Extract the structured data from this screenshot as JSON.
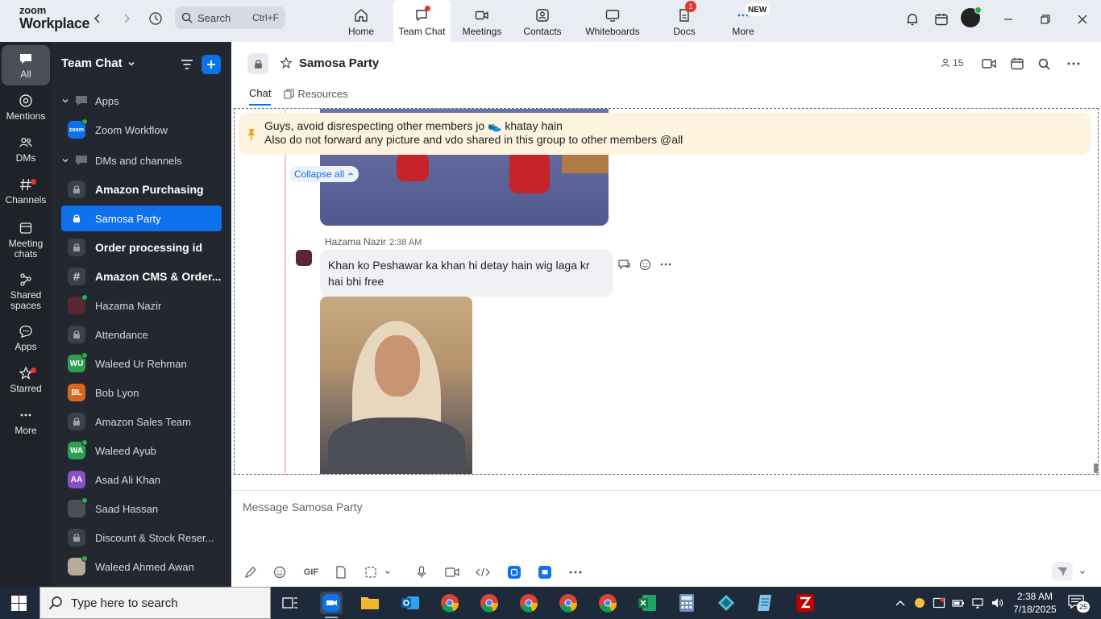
{
  "brand": {
    "line1": "zoom",
    "line2": "Workplace"
  },
  "search": {
    "label": "Search",
    "shortcut": "Ctrl+F"
  },
  "tabs": [
    {
      "label": "Home"
    },
    {
      "label": "Team Chat"
    },
    {
      "label": "Meetings"
    },
    {
      "label": "Contacts"
    },
    {
      "label": "Whiteboards"
    },
    {
      "label": "Docs",
      "badge": "1"
    },
    {
      "label": "More",
      "badge": "NEW"
    }
  ],
  "rail": [
    {
      "label": "All"
    },
    {
      "label": "Mentions"
    },
    {
      "label": "DMs"
    },
    {
      "label": "Channels"
    },
    {
      "label": "Meeting chats"
    },
    {
      "label": "Shared spaces"
    },
    {
      "label": "Apps"
    },
    {
      "label": "Starred"
    },
    {
      "label": "More"
    }
  ],
  "sidebar": {
    "title": "Team Chat",
    "sections": {
      "apps": "Apps",
      "dms": "DMs and channels"
    },
    "items": [
      {
        "label": "Zoom Workflow",
        "initials": "zoom"
      },
      {
        "label": "Amazon Purchasing"
      },
      {
        "label": "Samosa Party"
      },
      {
        "label": "Order processing id"
      },
      {
        "label": "Amazon CMS & Order..."
      },
      {
        "label": "Hazama Nazir"
      },
      {
        "label": "Attendance"
      },
      {
        "label": "Waleed Ur Rehman",
        "initials": "WU"
      },
      {
        "label": "Bob Lyon",
        "initials": "BL"
      },
      {
        "label": "Amazon Sales Team"
      },
      {
        "label": "Waleed Ayub",
        "initials": "WA"
      },
      {
        "label": "Asad Ali Khan",
        "initials": "AA"
      },
      {
        "label": "Saad Hassan"
      },
      {
        "label": "Discount & Stock Reser..."
      },
      {
        "label": "Waleed Ahmed Awan"
      }
    ]
  },
  "channel": {
    "title": "Samosa Party",
    "members": "15",
    "tabs": [
      {
        "label": "Chat"
      },
      {
        "label": "Resources"
      }
    ]
  },
  "pinned": {
    "line1": "Guys, avoid disrespecting other members jo 👟 khatay hain",
    "line2": "Also do not forward any picture and vdo shared in this group to other members @all"
  },
  "collapse_label": "Collapse all",
  "message": {
    "sender": "Hazama Nazir",
    "time": "2:38 AM",
    "text": "Khan ko Peshawar ka khan hi detay hain wig laga kr hai bhi free"
  },
  "composer": {
    "placeholder": "Message Samosa Party",
    "gif": "GIF"
  },
  "taskbar": {
    "search_placeholder": "Type here to search",
    "time": "2:38 AM",
    "date": "7/18/2025",
    "notifications": "25"
  },
  "colors": {
    "accent": "#0e72ed",
    "sidebar_bg": "#232830",
    "rail_bg": "#1f2329",
    "pin_bg": "#fdf3de",
    "alert": "#e8352e"
  }
}
